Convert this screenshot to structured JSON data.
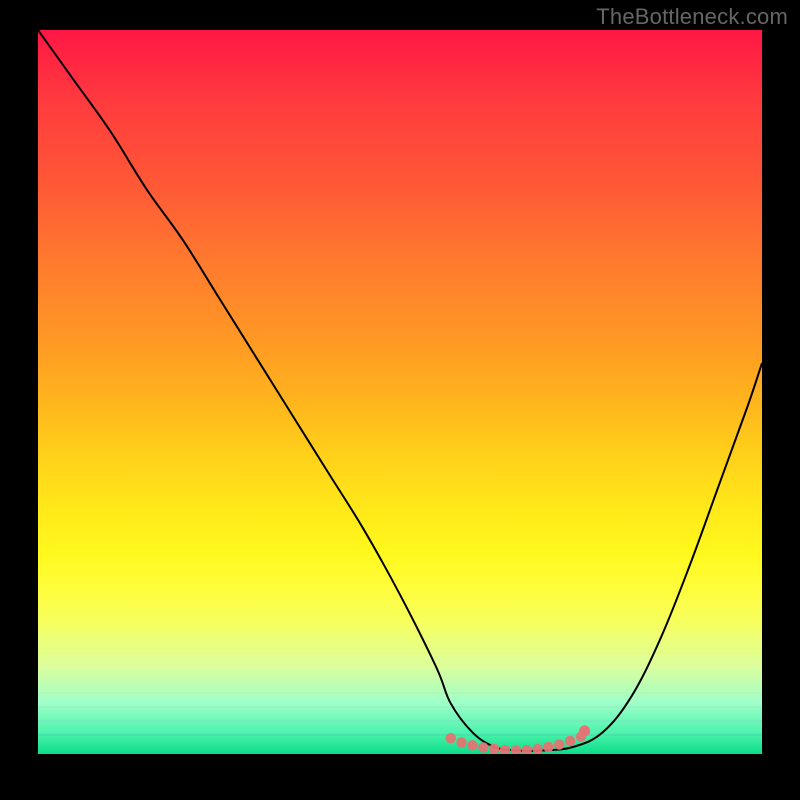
{
  "watermark": "TheBottleneck.com",
  "colors": {
    "background": "#000000",
    "curve_stroke": "#000000",
    "marker_stroke": "#e57373",
    "marker_fill": "#e57373"
  },
  "chart_data": {
    "type": "line",
    "title": "",
    "xlabel": "",
    "ylabel": "",
    "xlim": [
      0,
      100
    ],
    "ylim": [
      0,
      100
    ],
    "series": [
      {
        "name": "bottleneck-curve",
        "x": [
          0,
          5,
          10,
          15,
          20,
          25,
          30,
          35,
          40,
          45,
          50,
          55,
          57,
          60,
          63,
          66,
          70,
          74,
          78,
          82,
          86,
          90,
          94,
          98,
          100
        ],
        "y": [
          100,
          93,
          86,
          78,
          71,
          63,
          55,
          47,
          39,
          31,
          22,
          12,
          7,
          3,
          1,
          0.5,
          0.5,
          1,
          3,
          8,
          16,
          26,
          37,
          48,
          54
        ]
      }
    ],
    "markers": {
      "name": "highlight-band",
      "x": [
        57,
        58.5,
        60,
        61.5,
        63,
        64.5,
        66,
        67.5,
        69,
        70.5,
        72,
        73.5,
        75
      ],
      "y": [
        2.2,
        1.6,
        1.2,
        0.9,
        0.7,
        0.55,
        0.5,
        0.55,
        0.7,
        0.95,
        1.3,
        1.8,
        2.4
      ],
      "end_point": {
        "x": 75.5,
        "y": 3.2
      }
    }
  }
}
